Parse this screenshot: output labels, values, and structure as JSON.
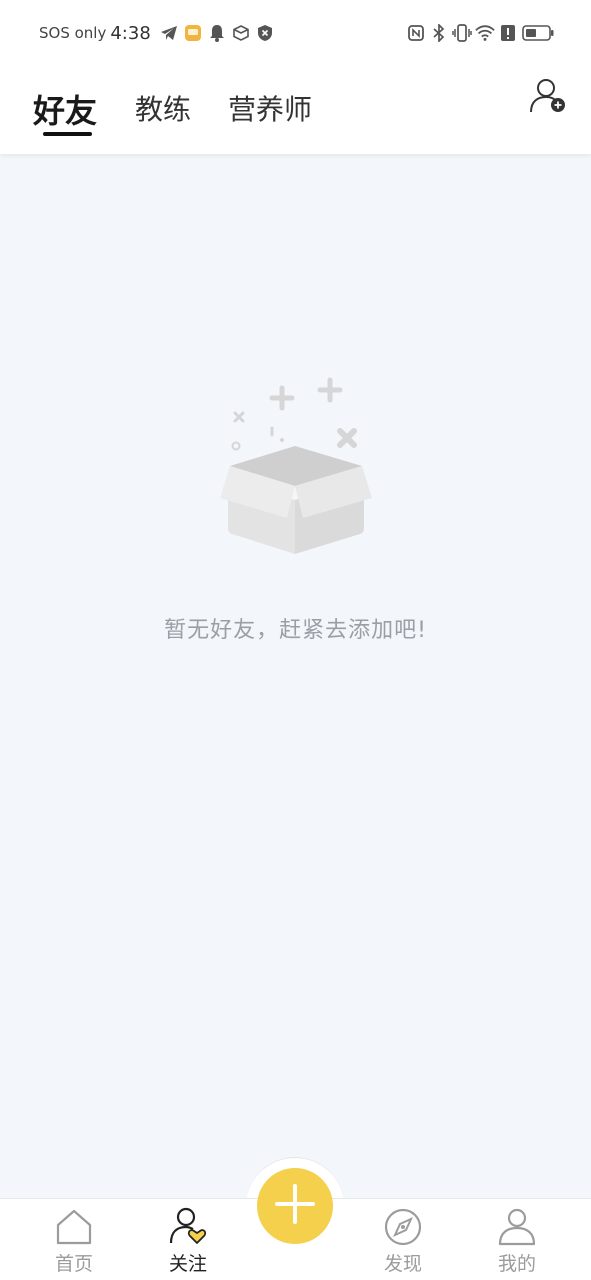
{
  "status_bar": {
    "carrier": "SOS only",
    "time": "4:38",
    "left_icons": [
      "telegram-icon",
      "app-notification-icon",
      "bell-icon",
      "package-icon",
      "shield-icon"
    ],
    "right_icons": [
      "nfc-icon",
      "bluetooth-icon",
      "vibrate-icon",
      "wifi-icon",
      "alert-icon",
      "battery-icon"
    ]
  },
  "tabs": [
    {
      "label": "好友",
      "active": true
    },
    {
      "label": "教练",
      "active": false
    },
    {
      "label": "营养师",
      "active": false
    }
  ],
  "add_friend_icon": "add-user-icon",
  "empty_state": {
    "icon": "empty-box-icon",
    "message": "暂无好友，赶紧去添加吧!"
  },
  "bottom_nav": {
    "items": [
      {
        "label": "首页",
        "icon": "home-icon",
        "active": false
      },
      {
        "label": "关注",
        "icon": "follow-icon",
        "active": true
      },
      {
        "label": "发现",
        "icon": "compass-icon",
        "active": false
      },
      {
        "label": "我的",
        "icon": "profile-icon",
        "active": false
      }
    ],
    "fab_icon": "plus-icon"
  },
  "colors": {
    "accent": "#f5d04c",
    "background": "#f3f6fa",
    "active_text": "#222222",
    "inactive_text": "#9c9c9c"
  }
}
